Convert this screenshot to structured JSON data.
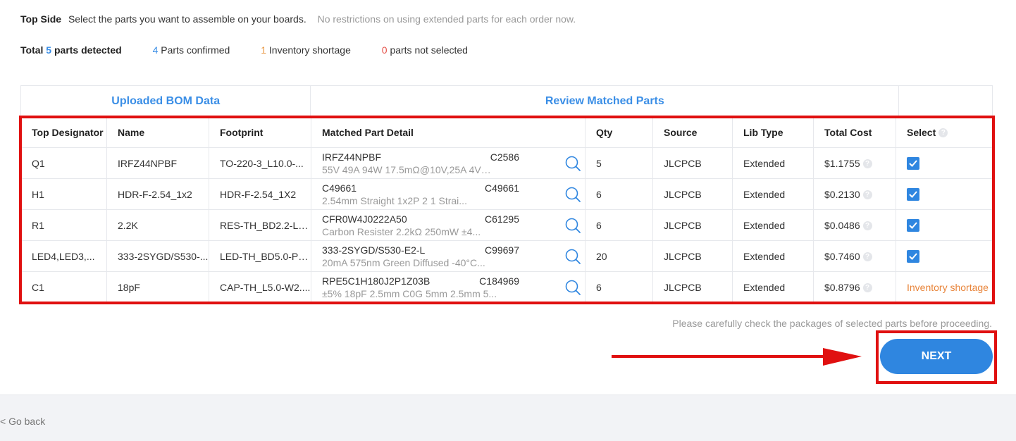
{
  "header": {
    "side": "Top Side",
    "description": "Select the parts you want to assemble on your boards.",
    "note": "No restrictions on using extended parts for each order now."
  },
  "summary": {
    "total_prefix": "Total",
    "total_count": "5",
    "total_suffix": "parts detected",
    "confirmed_count": "4",
    "confirmed_label": "Parts confirmed",
    "shortage_count": "1",
    "shortage_label": "Inventory shortage",
    "not_selected_count": "0",
    "not_selected_label": "parts not selected"
  },
  "groups": {
    "uploaded": "Uploaded BOM Data",
    "review": "Review Matched Parts"
  },
  "columns": {
    "designator": "Top Designator",
    "name": "Name",
    "footprint": "Footprint",
    "matched": "Matched Part Detail",
    "qty": "Qty",
    "source": "Source",
    "lib_type": "Lib Type",
    "total_cost": "Total Cost",
    "select": "Select"
  },
  "rows": [
    {
      "designator": "Q1",
      "name": "IRFZ44NPBF",
      "footprint": "TO-220-3_L10.0-...",
      "part": "IRFZ44NPBF",
      "code": "C2586",
      "desc": "55V 49A 94W 17.5mΩ@10V,25A 4V@...",
      "qty": "5",
      "source": "JLCPCB",
      "lib_type": "Extended",
      "cost": "$1.1755",
      "status": "selected"
    },
    {
      "designator": "H1",
      "name": "HDR-F-2.54_1x2",
      "footprint": "HDR-F-2.54_1X2",
      "part": "C49661",
      "code": "C49661",
      "desc": "2.54mm Straight 1x2P 2 1 Strai...",
      "qty": "6",
      "source": "JLCPCB",
      "lib_type": "Extended",
      "cost": "$0.2130",
      "status": "selected"
    },
    {
      "designator": "R1",
      "name": "2.2K",
      "footprint": "RES-TH_BD2.2-L6....",
      "part": "CFR0W4J0222A50",
      "code": "C61295",
      "desc": "Carbon Resister 2.2kΩ 250mW ±4...",
      "qty": "6",
      "source": "JLCPCB",
      "lib_type": "Extended",
      "cost": "$0.0486",
      "status": "selected"
    },
    {
      "designator": "LED4,LED3,...",
      "name": "333-2SYGD/S530-...",
      "footprint": "LED-TH_BD5.0-P2...",
      "part": "333-2SYGD/S530-E2-L",
      "code": "C99697",
      "desc": "20mA 575nm Green Diffused -40°C...",
      "qty": "20",
      "source": "JLCPCB",
      "lib_type": "Extended",
      "cost": "$0.7460",
      "status": "selected"
    },
    {
      "designator": "C1",
      "name": "18pF",
      "footprint": "CAP-TH_L5.0-W2....",
      "part": "RPE5C1H180J2P1Z03B",
      "code": "C184969",
      "desc": "±5% 18pF 2.5mm C0G 5mm 2.5mm 5...",
      "qty": "6",
      "source": "JLCPCB",
      "lib_type": "Extended",
      "cost": "$0.8796",
      "status": "Inventory shortage"
    }
  ],
  "hint": "Please carefully check the packages of selected parts before proceeding.",
  "next_label": "NEXT",
  "go_back": "< Go back",
  "colors": {
    "accent": "#2f86e0",
    "highlight": "#e01010",
    "warning": "#e8843a"
  }
}
